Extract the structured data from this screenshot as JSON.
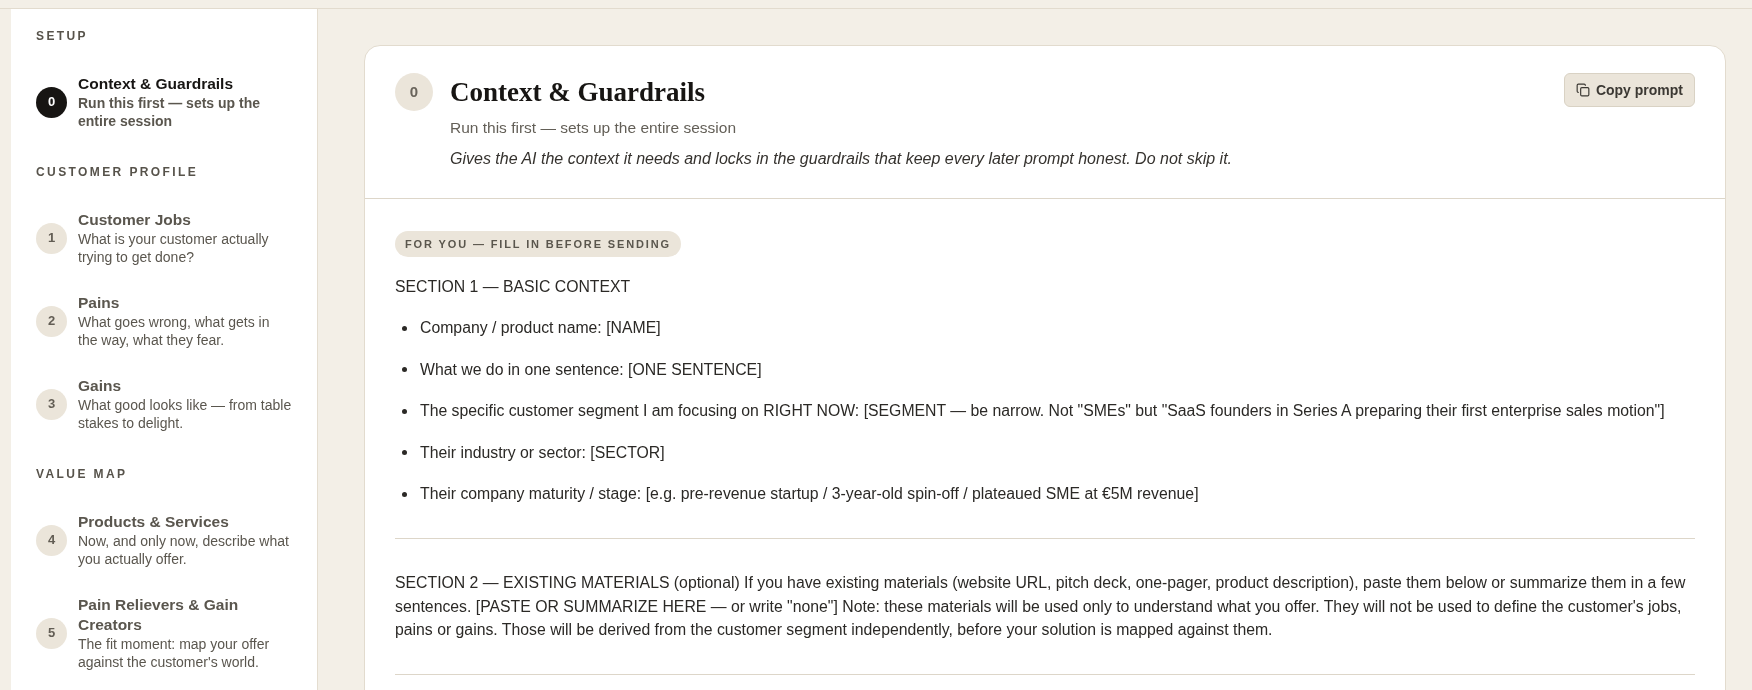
{
  "sidebar": {
    "groups": [
      {
        "label": "SETUP",
        "items": [
          {
            "number": "0",
            "title": "Context & Guardrails",
            "description": "Run this first — sets up the entire session",
            "selected": true
          }
        ]
      },
      {
        "label": "CUSTOMER PROFILE",
        "items": [
          {
            "number": "1",
            "title": "Customer Jobs",
            "description": "What is your customer actually trying to get done?",
            "selected": false
          },
          {
            "number": "2",
            "title": "Pains",
            "description": "What goes wrong, what gets in the way, what they fear.",
            "selected": false
          },
          {
            "number": "3",
            "title": "Gains",
            "description": "What good looks like — from table stakes to delight.",
            "selected": false
          }
        ]
      },
      {
        "label": "VALUE MAP",
        "items": [
          {
            "number": "4",
            "title": "Products & Services",
            "description": "Now, and only now, describe what you actually offer.",
            "selected": false
          },
          {
            "number": "5",
            "title": "Pain Relievers & Gain Creators",
            "description": "The fit moment: map your offer against the customer's world.",
            "selected": false
          }
        ]
      }
    ]
  },
  "prompt": {
    "number": "0",
    "title": "Context & Guardrails",
    "subtitle": "Run this first — sets up the entire session",
    "intro": "Gives the AI the context it needs and locks in the guardrails that keep every later prompt honest. Do not skip it.",
    "copy_button": "Copy prompt",
    "badge": "FOR YOU — FILL IN BEFORE SENDING",
    "sections": [
      {
        "kind": "list",
        "heading": "SECTION 1 — BASIC CONTEXT",
        "items": [
          "Company / product name: [NAME]",
          "What we do in one sentence: [ONE SENTENCE]",
          "The specific customer segment I am focusing on RIGHT NOW: [SEGMENT — be narrow. Not \"SMEs\" but \"SaaS founders in Series A preparing their first enterprise sales motion\"]",
          "Their industry or sector: [SECTOR]",
          "Their company maturity / stage: [e.g. pre-revenue startup / 3-year-old spin-off / plateaued SME at €5M revenue]"
        ]
      },
      {
        "kind": "paragraph",
        "text": "SECTION 2 — EXISTING MATERIALS (optional) If you have existing materials (website URL, pitch deck, one-pager, product description), paste them below or summarize them in a few sentences. [PASTE OR SUMMARIZE HERE — or write \"none\"] Note: these materials will be used only to understand what you offer. They will not be used to define the customer's jobs, pains or gains. Those will be derived from the customer segment independently, before your solution is mapped against them."
      }
    ]
  }
}
